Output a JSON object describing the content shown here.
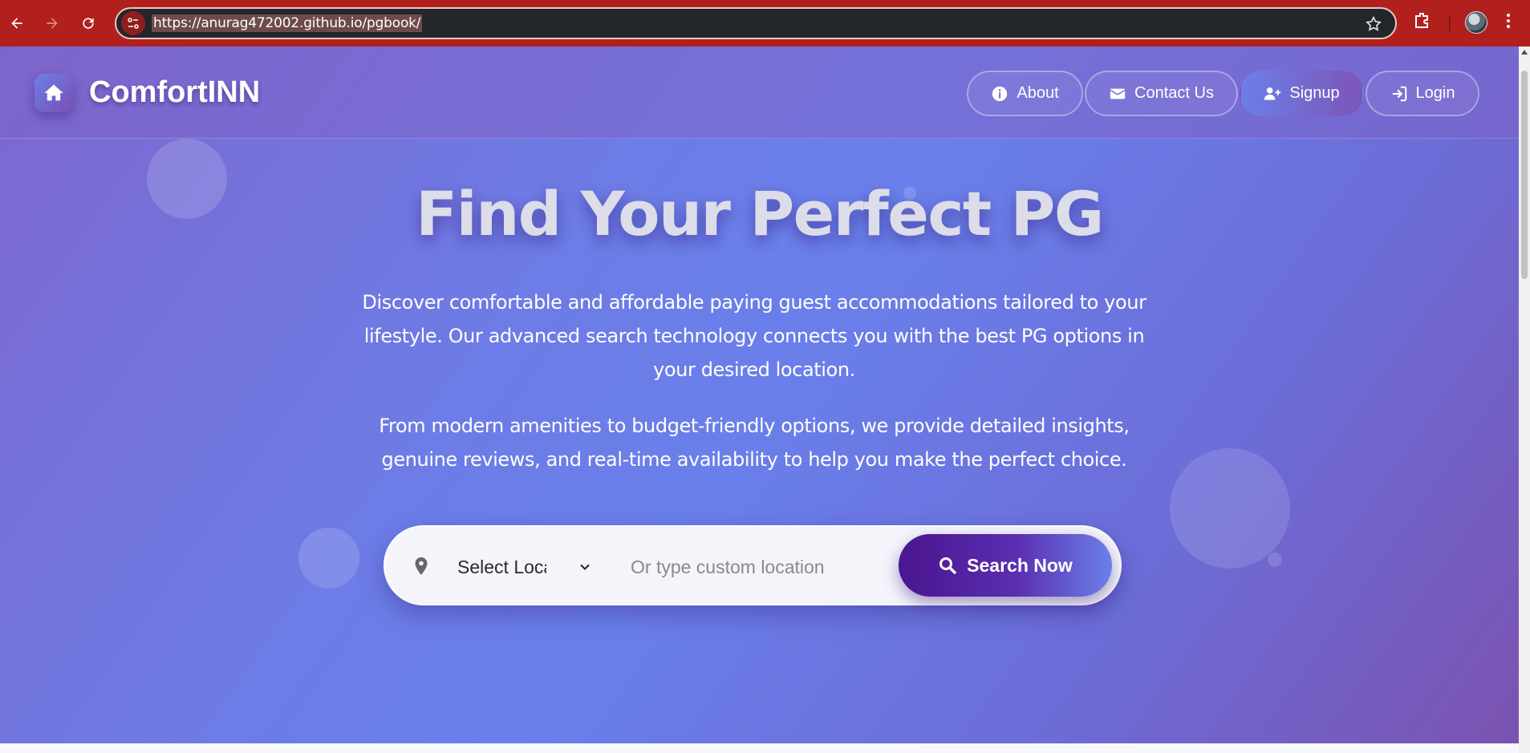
{
  "browser": {
    "url": "https://anurag472002.github.io/pgbook/"
  },
  "site": {
    "brand": "ComfortINN",
    "nav": [
      {
        "label": "About",
        "icon": "info-icon"
      },
      {
        "label": "Contact Us",
        "icon": "envelope-icon"
      },
      {
        "label": "Signup",
        "icon": "user-plus-icon"
      },
      {
        "label": "Login",
        "icon": "sign-in-icon"
      }
    ]
  },
  "hero": {
    "title": "Find Your Perfect PG",
    "description_1": "Discover comfortable and affordable paying guest accommodations tailored to your lifestyle. Our advanced search technology connects you with the best PG options in your desired location.",
    "description_2": "From modern amenities to budget-friendly options, we provide detailed insights, genuine reviews, and real-time availability to help you make the perfect choice."
  },
  "search": {
    "location_select_value": "Select Location",
    "custom_location_placeholder": "Or type custom location",
    "button_label": "Search Now"
  },
  "colors": {
    "browser_frame": "#b2201d",
    "accent_dark": "#4a1590",
    "accent_light": "#6b80e8"
  }
}
